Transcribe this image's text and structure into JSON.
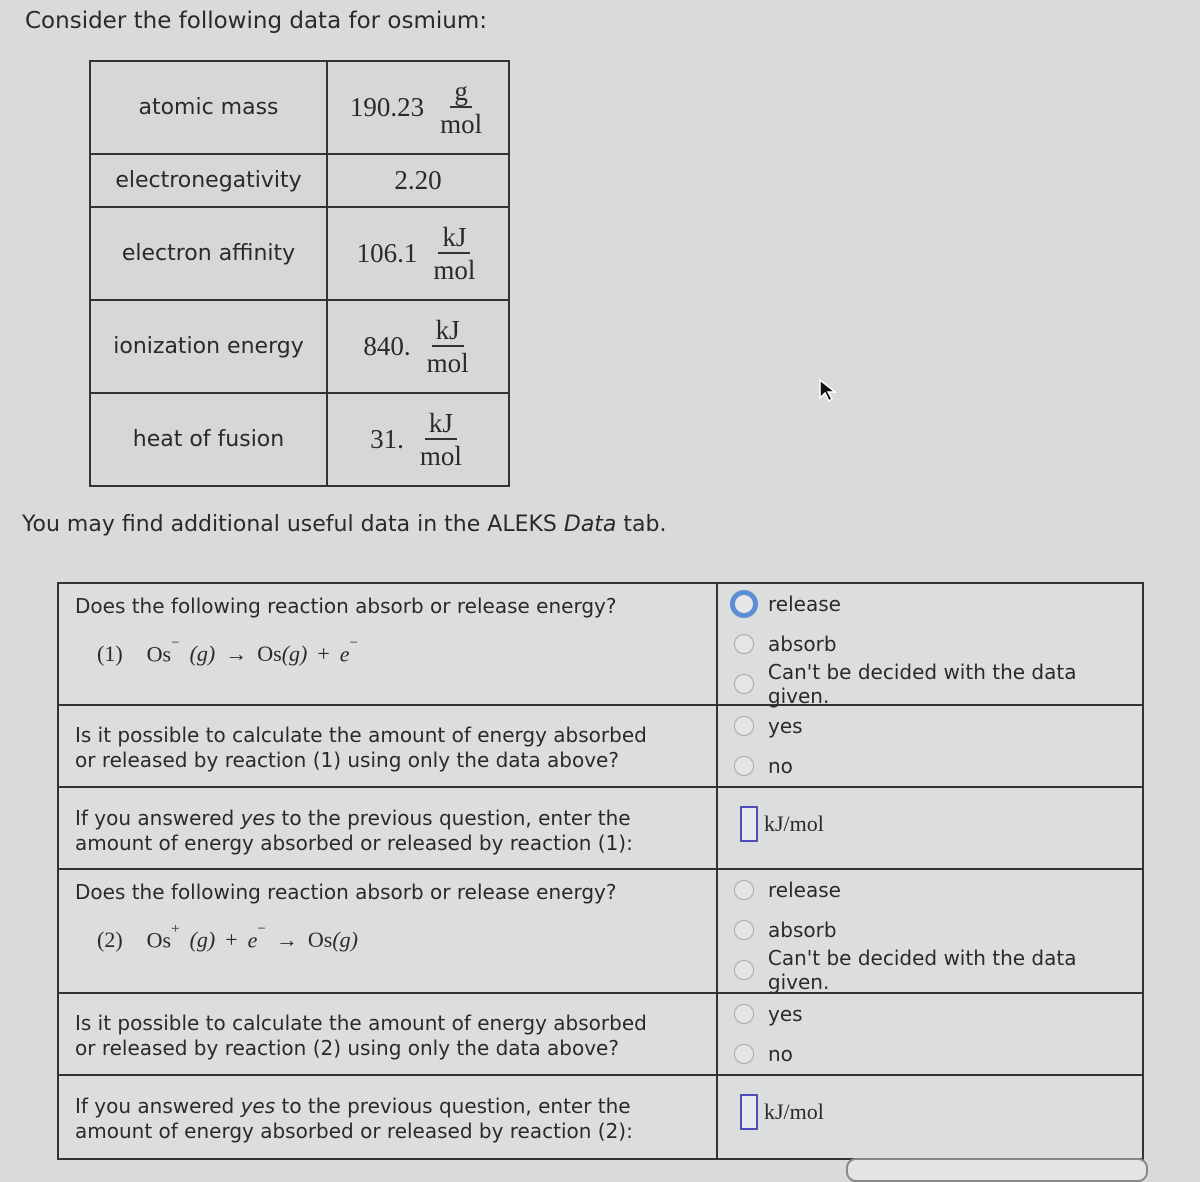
{
  "intro": "Consider the following data for osmium:",
  "properties": [
    {
      "label": "atomic mass",
      "value": "190.23",
      "unit_num": "g",
      "unit_den": "mol"
    },
    {
      "label": "electronegativity",
      "value": "2.20",
      "unit_num": "",
      "unit_den": ""
    },
    {
      "label": "electron affinity",
      "value": "106.1",
      "unit_num": "kJ",
      "unit_den": "mol"
    },
    {
      "label": "ionization energy",
      "value": "840.",
      "unit_num": "kJ",
      "unit_den": "mol"
    },
    {
      "label": "heat of fusion",
      "value": "31.",
      "unit_num": "kJ",
      "unit_den": "mol"
    }
  ],
  "note": {
    "before": "You may find additional useful data in the ALEKS ",
    "italic": "Data",
    "after": " tab."
  },
  "reactions": [
    {
      "question": "Does the following reaction absorb or release energy?",
      "number": "(1)",
      "equation": {
        "reactant": "Os",
        "reactant_charge": "−",
        "reactant_state": "(g)",
        "arrow": "→",
        "product": "Os",
        "product_state": "(g)",
        "plus": "+",
        "electron": "e",
        "electron_charge": "−"
      },
      "options": [
        "release",
        "absorb",
        "Can't be decided with the data given."
      ],
      "focused_option": "release",
      "possible_question_1": "Is it possible to calculate the amount of energy absorbed",
      "possible_question_2": "or released by reaction (1) using only the data above?",
      "yesno": [
        "yes",
        "no"
      ],
      "enter_1a": "If you answered ",
      "enter_1b": "yes",
      "enter_1c": " to the previous question, enter the",
      "enter_2": "amount of energy absorbed or released by reaction (1):",
      "answer_value": "",
      "unit": "kJ/mol"
    },
    {
      "question": "Does the following reaction absorb or release energy?",
      "number": "(2)",
      "equation": {
        "reactant": "Os",
        "reactant_charge": "+",
        "reactant_state": "(g)",
        "plus": "+",
        "electron": "e",
        "electron_charge": "−",
        "arrow": "→",
        "product": "Os",
        "product_state": "(g)"
      },
      "options": [
        "release",
        "absorb",
        "Can't be decided with the data given."
      ],
      "possible_question_1": "Is it possible to calculate the amount of energy absorbed",
      "possible_question_2": "or released by reaction (2) using only the data above?",
      "yesno": [
        "yes",
        "no"
      ],
      "enter_1a": "If you answered ",
      "enter_1b": "yes",
      "enter_1c": " to the previous question, enter the",
      "enter_2": "amount of energy absorbed or released by reaction (2):",
      "answer_value": "",
      "unit": "kJ/mol"
    }
  ]
}
